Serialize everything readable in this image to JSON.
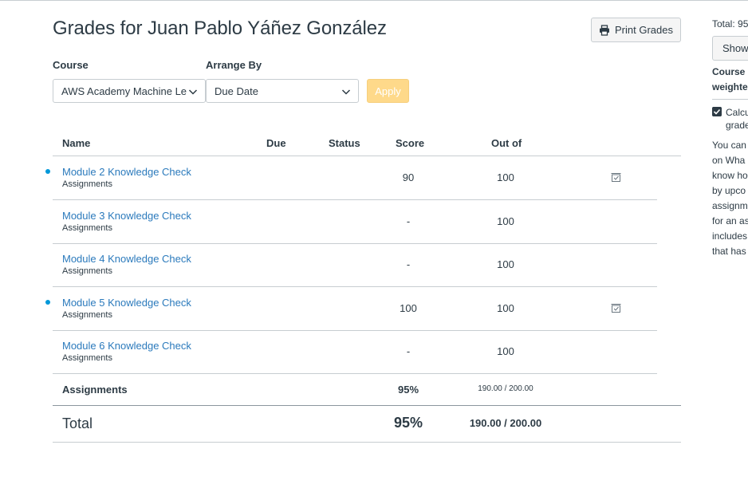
{
  "page": {
    "title": "Grades for Juan Pablo Yáñez González",
    "print_label": "Print Grades"
  },
  "filters": {
    "course_label": "Course",
    "course_value": "AWS Academy Machine Le",
    "arrange_label": "Arrange By",
    "arrange_value": "Due Date",
    "apply_label": "Apply"
  },
  "table": {
    "headers": {
      "name": "Name",
      "due": "Due",
      "status": "Status",
      "score": "Score",
      "outof": "Out of"
    },
    "rows": [
      {
        "name": "Module 2 Knowledge Check",
        "group": "Assignments",
        "score": "90",
        "out_of": "100",
        "unread": true,
        "muted_icon": true
      },
      {
        "name": "Module 3 Knowledge Check",
        "group": "Assignments",
        "score": "-",
        "out_of": "100",
        "unread": false,
        "muted_icon": false
      },
      {
        "name": "Module 4 Knowledge Check",
        "group": "Assignments",
        "score": "-",
        "out_of": "100",
        "unread": false,
        "muted_icon": false
      },
      {
        "name": "Module 5 Knowledge Check",
        "group": "Assignments",
        "score": "100",
        "out_of": "100",
        "unread": true,
        "muted_icon": true
      },
      {
        "name": "Module 6 Knowledge Check",
        "group": "Assignments",
        "score": "-",
        "out_of": "100",
        "unread": false,
        "muted_icon": false
      }
    ],
    "group_total": {
      "name": "Assignments",
      "score": "95%",
      "out_of": "190.00 / 200.00"
    },
    "total": {
      "name": "Total",
      "score": "95%",
      "out_of": "190.00 / 200.00"
    }
  },
  "sidebar": {
    "total_text": "Total: 95",
    "show_label": "Show",
    "course_line1": "Course a",
    "course_line2": "weighte",
    "check_line1": "Calcu",
    "check_line2": "grade",
    "info_lines": [
      "You can",
      "on Wha",
      "know ho",
      "by upco",
      "assignm",
      "for an as",
      "includes",
      "that has"
    ]
  },
  "colors": {
    "link": "#2b7abc",
    "unread_dot": "#0098d9",
    "apply_disabled": "#fed98a",
    "text": "#2d3b45"
  },
  "icons": {
    "print": "printer-icon",
    "dropdown": "chevron-down-icon",
    "row_action": "muted-assignment-icon",
    "checkbox": "checkbox-checked-icon"
  }
}
